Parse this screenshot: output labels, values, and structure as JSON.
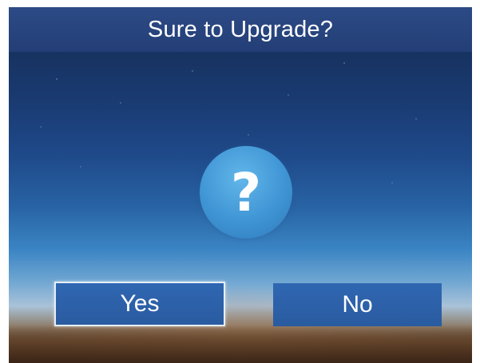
{
  "dialog": {
    "title": "Sure to Upgrade?",
    "icon": "question-icon",
    "icon_glyph": "?",
    "buttons": {
      "yes_label": "Yes",
      "no_label": "No",
      "focused": "yes"
    }
  },
  "colors": {
    "title_bar": "#2c4a86",
    "button": "#2f67b2",
    "icon_circle": "#3f95d4",
    "focus_border": "#e6eef8",
    "text": "#ffffff"
  }
}
